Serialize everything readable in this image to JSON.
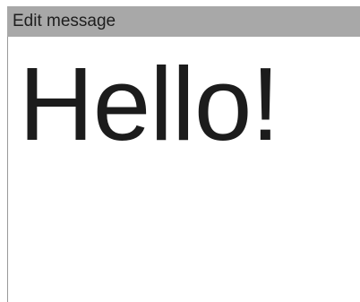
{
  "window": {
    "title": "Edit message"
  },
  "editor": {
    "message": "Hello!"
  },
  "colors": {
    "title_bar_bg": "#a8a8a8",
    "text": "#1c1c1c",
    "background": "#ffffff"
  }
}
